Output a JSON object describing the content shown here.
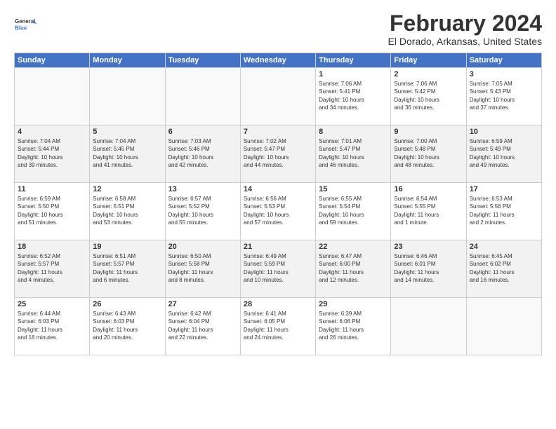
{
  "header": {
    "logo_line1": "General",
    "logo_line2": "Blue",
    "month": "February 2024",
    "location": "El Dorado, Arkansas, United States"
  },
  "weekdays": [
    "Sunday",
    "Monday",
    "Tuesday",
    "Wednesday",
    "Thursday",
    "Friday",
    "Saturday"
  ],
  "weeks": [
    {
      "shaded": false,
      "days": [
        {
          "num": "",
          "info": ""
        },
        {
          "num": "",
          "info": ""
        },
        {
          "num": "",
          "info": ""
        },
        {
          "num": "",
          "info": ""
        },
        {
          "num": "1",
          "info": "Sunrise: 7:06 AM\nSunset: 5:41 PM\nDaylight: 10 hours\nand 34 minutes."
        },
        {
          "num": "2",
          "info": "Sunrise: 7:06 AM\nSunset: 5:42 PM\nDaylight: 10 hours\nand 36 minutes."
        },
        {
          "num": "3",
          "info": "Sunrise: 7:05 AM\nSunset: 5:43 PM\nDaylight: 10 hours\nand 37 minutes."
        }
      ]
    },
    {
      "shaded": true,
      "days": [
        {
          "num": "4",
          "info": "Sunrise: 7:04 AM\nSunset: 5:44 PM\nDaylight: 10 hours\nand 39 minutes."
        },
        {
          "num": "5",
          "info": "Sunrise: 7:04 AM\nSunset: 5:45 PM\nDaylight: 10 hours\nand 41 minutes."
        },
        {
          "num": "6",
          "info": "Sunrise: 7:03 AM\nSunset: 5:46 PM\nDaylight: 10 hours\nand 42 minutes."
        },
        {
          "num": "7",
          "info": "Sunrise: 7:02 AM\nSunset: 5:47 PM\nDaylight: 10 hours\nand 44 minutes."
        },
        {
          "num": "8",
          "info": "Sunrise: 7:01 AM\nSunset: 5:47 PM\nDaylight: 10 hours\nand 46 minutes."
        },
        {
          "num": "9",
          "info": "Sunrise: 7:00 AM\nSunset: 5:48 PM\nDaylight: 10 hours\nand 48 minutes."
        },
        {
          "num": "10",
          "info": "Sunrise: 6:59 AM\nSunset: 5:49 PM\nDaylight: 10 hours\nand 49 minutes."
        }
      ]
    },
    {
      "shaded": false,
      "days": [
        {
          "num": "11",
          "info": "Sunrise: 6:59 AM\nSunset: 5:50 PM\nDaylight: 10 hours\nand 51 minutes."
        },
        {
          "num": "12",
          "info": "Sunrise: 6:58 AM\nSunset: 5:51 PM\nDaylight: 10 hours\nand 53 minutes."
        },
        {
          "num": "13",
          "info": "Sunrise: 6:57 AM\nSunset: 5:52 PM\nDaylight: 10 hours\nand 55 minutes."
        },
        {
          "num": "14",
          "info": "Sunrise: 6:56 AM\nSunset: 5:53 PM\nDaylight: 10 hours\nand 57 minutes."
        },
        {
          "num": "15",
          "info": "Sunrise: 6:55 AM\nSunset: 5:54 PM\nDaylight: 10 hours\nand 59 minutes."
        },
        {
          "num": "16",
          "info": "Sunrise: 6:54 AM\nSunset: 5:55 PM\nDaylight: 11 hours\nand 1 minute."
        },
        {
          "num": "17",
          "info": "Sunrise: 6:53 AM\nSunset: 5:56 PM\nDaylight: 11 hours\nand 2 minutes."
        }
      ]
    },
    {
      "shaded": true,
      "days": [
        {
          "num": "18",
          "info": "Sunrise: 6:52 AM\nSunset: 5:57 PM\nDaylight: 11 hours\nand 4 minutes."
        },
        {
          "num": "19",
          "info": "Sunrise: 6:51 AM\nSunset: 5:57 PM\nDaylight: 11 hours\nand 6 minutes."
        },
        {
          "num": "20",
          "info": "Sunrise: 6:50 AM\nSunset: 5:58 PM\nDaylight: 11 hours\nand 8 minutes."
        },
        {
          "num": "21",
          "info": "Sunrise: 6:49 AM\nSunset: 5:59 PM\nDaylight: 11 hours\nand 10 minutes."
        },
        {
          "num": "22",
          "info": "Sunrise: 6:47 AM\nSunset: 6:00 PM\nDaylight: 11 hours\nand 12 minutes."
        },
        {
          "num": "23",
          "info": "Sunrise: 6:46 AM\nSunset: 6:01 PM\nDaylight: 11 hours\nand 14 minutes."
        },
        {
          "num": "24",
          "info": "Sunrise: 6:45 AM\nSunset: 6:02 PM\nDaylight: 11 hours\nand 16 minutes."
        }
      ]
    },
    {
      "shaded": false,
      "days": [
        {
          "num": "25",
          "info": "Sunrise: 6:44 AM\nSunset: 6:03 PM\nDaylight: 11 hours\nand 18 minutes."
        },
        {
          "num": "26",
          "info": "Sunrise: 6:43 AM\nSunset: 6:03 PM\nDaylight: 11 hours\nand 20 minutes."
        },
        {
          "num": "27",
          "info": "Sunrise: 6:42 AM\nSunset: 6:04 PM\nDaylight: 11 hours\nand 22 minutes."
        },
        {
          "num": "28",
          "info": "Sunrise: 6:41 AM\nSunset: 6:05 PM\nDaylight: 11 hours\nand 24 minutes."
        },
        {
          "num": "29",
          "info": "Sunrise: 6:39 AM\nSunset: 6:06 PM\nDaylight: 11 hours\nand 26 minutes."
        },
        {
          "num": "",
          "info": ""
        },
        {
          "num": "",
          "info": ""
        }
      ]
    }
  ]
}
